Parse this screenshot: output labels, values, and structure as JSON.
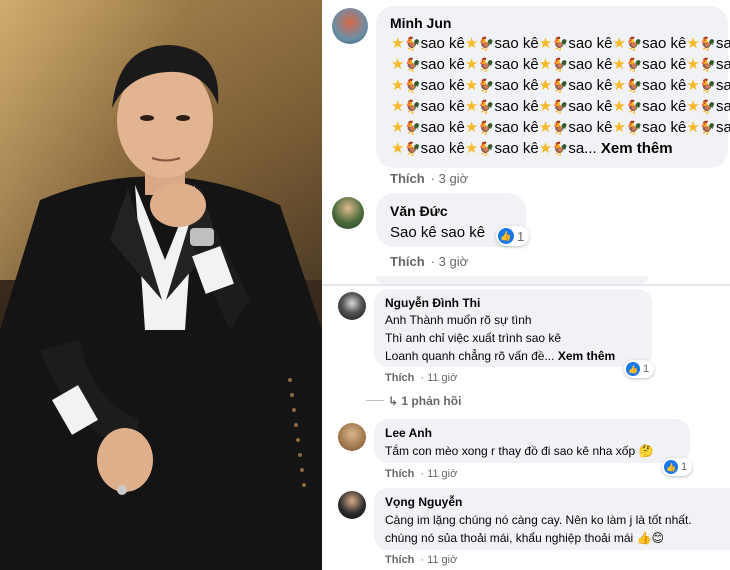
{
  "photo": {
    "description_icon": "person-portrait"
  },
  "comments": [
    {
      "name": "Minh Jun",
      "emoji_unit_text": "sao kê",
      "truncated_tail": "sa...",
      "see_more": "Xem thêm",
      "like_label": "Thích",
      "time": "3 giờ"
    },
    {
      "name": "Văn Đức",
      "text": "Sao kê sao kê",
      "reaction_count": "1",
      "like_label": "Thích",
      "time": "3 giờ"
    }
  ],
  "replies": [
    {
      "name": "Nguyễn Đình Thi",
      "lines": [
        "Anh Thành muốn rõ sự tình",
        "Thì anh chỉ việc xuất trình sao kê",
        "Loanh quanh chẳng rõ vấn đề..."
      ],
      "see_more": "Xem thêm",
      "reaction_count": "1",
      "like_label": "Thích",
      "time": "11 giờ",
      "reply_count": "1 phản hồi"
    },
    {
      "name": "Lee Anh",
      "text": "Tắm con mèo xong r thay đồ đi sao kê nha xốp 🤔",
      "reaction_count": "1",
      "like_label": "Thích",
      "time": "11 giờ"
    },
    {
      "name": "Vọng Nguyễn",
      "lines": [
        "Càng im lặng chúng nó càng cay. Nên ko làm j là tốt nhất.",
        "chúng nó sủa thoải mái, khẩu nghiệp thoải mái 👍😊"
      ],
      "like_label": "Thích",
      "time": "11 giờ"
    }
  ],
  "colors": {
    "bubble": "#f0f2f5",
    "meta": "#65676b",
    "like_blue": "#1877f2"
  }
}
